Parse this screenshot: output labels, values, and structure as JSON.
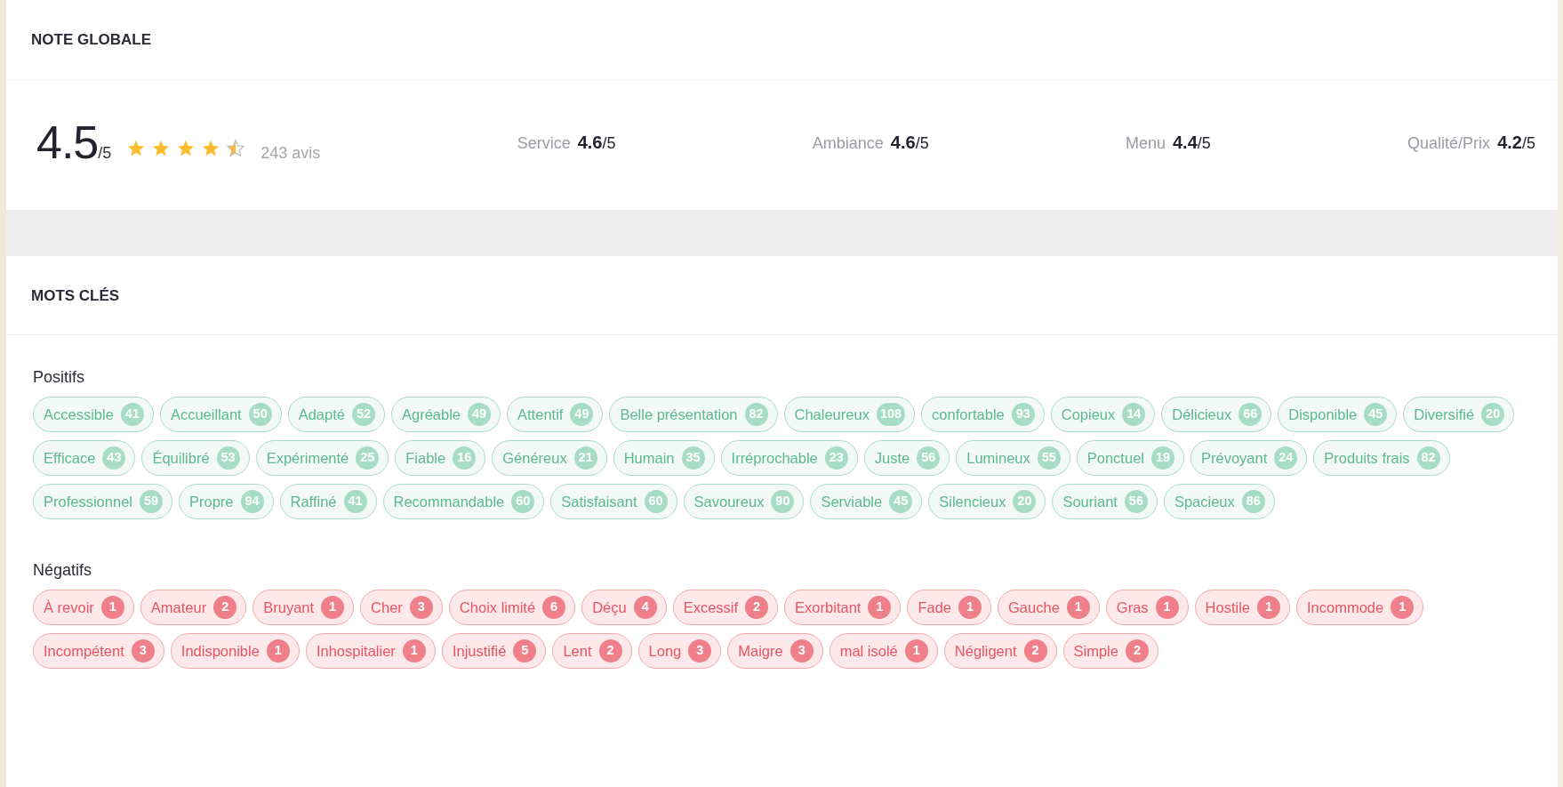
{
  "overall": {
    "title": "NOTE GLOBALE",
    "score": "4.5",
    "max": "/5",
    "stars": 4.5,
    "reviews": "243 avis",
    "criteria": [
      {
        "label": "Service",
        "value": "4.6",
        "max": "/5"
      },
      {
        "label": "Ambiance",
        "value": "4.6",
        "max": "/5"
      },
      {
        "label": "Menu",
        "value": "4.4",
        "max": "/5"
      },
      {
        "label": "Qualité/Prix",
        "value": "4.2",
        "max": "/5"
      }
    ]
  },
  "keywords": {
    "title": "MOTS CLÉS",
    "groups": [
      {
        "label": "Positifs",
        "kind": "positive",
        "tags": [
          {
            "label": "Accessible",
            "count": "41"
          },
          {
            "label": "Accueillant",
            "count": "50"
          },
          {
            "label": "Adapté",
            "count": "52"
          },
          {
            "label": "Agréable",
            "count": "49"
          },
          {
            "label": "Attentif",
            "count": "49"
          },
          {
            "label": "Belle présentation",
            "count": "82"
          },
          {
            "label": "Chaleureux",
            "count": "108"
          },
          {
            "label": "confortable",
            "count": "93"
          },
          {
            "label": "Copieux",
            "count": "14"
          },
          {
            "label": "Délicieux",
            "count": "66"
          },
          {
            "label": "Disponible",
            "count": "45"
          },
          {
            "label": "Diversifié",
            "count": "20"
          },
          {
            "label": "Efficace",
            "count": "43"
          },
          {
            "label": "Équilibré",
            "count": "53"
          },
          {
            "label": "Expérimenté",
            "count": "25"
          },
          {
            "label": "Fiable",
            "count": "16"
          },
          {
            "label": "Généreux",
            "count": "21"
          },
          {
            "label": "Humain",
            "count": "35"
          },
          {
            "label": "Irréprochable",
            "count": "23"
          },
          {
            "label": "Juste",
            "count": "56"
          },
          {
            "label": "Lumineux",
            "count": "55"
          },
          {
            "label": "Ponctuel",
            "count": "19"
          },
          {
            "label": "Prévoyant",
            "count": "24"
          },
          {
            "label": "Produits frais",
            "count": "82"
          },
          {
            "label": "Professionnel",
            "count": "59"
          },
          {
            "label": "Propre",
            "count": "94"
          },
          {
            "label": "Raffiné",
            "count": "41"
          },
          {
            "label": "Recommandable",
            "count": "60"
          },
          {
            "label": "Satisfaisant",
            "count": "60"
          },
          {
            "label": "Savoureux",
            "count": "90"
          },
          {
            "label": "Serviable",
            "count": "45"
          },
          {
            "label": "Silencieux",
            "count": "20"
          },
          {
            "label": "Souriant",
            "count": "56"
          },
          {
            "label": "Spacieux",
            "count": "86"
          }
        ]
      },
      {
        "label": "Négatifs",
        "kind": "negative",
        "tags": [
          {
            "label": "À revoir",
            "count": "1"
          },
          {
            "label": "Amateur",
            "count": "2"
          },
          {
            "label": "Bruyant",
            "count": "1"
          },
          {
            "label": "Cher",
            "count": "3"
          },
          {
            "label": "Choix limité",
            "count": "6"
          },
          {
            "label": "Déçu",
            "count": "4"
          },
          {
            "label": "Excessif",
            "count": "2"
          },
          {
            "label": "Exorbitant",
            "count": "1"
          },
          {
            "label": "Fade",
            "count": "1"
          },
          {
            "label": "Gauche",
            "count": "1"
          },
          {
            "label": "Gras",
            "count": "1"
          },
          {
            "label": "Hostile",
            "count": "1"
          },
          {
            "label": "Incommode",
            "count": "1"
          },
          {
            "label": "Incompétent",
            "count": "3"
          },
          {
            "label": "Indisponible",
            "count": "1"
          },
          {
            "label": "Inhospitalier",
            "count": "1"
          },
          {
            "label": "Injustifié",
            "count": "5"
          },
          {
            "label": "Lent",
            "count": "2"
          },
          {
            "label": "Long",
            "count": "3"
          },
          {
            "label": "Maigre",
            "count": "3"
          },
          {
            "label": "mal isolé",
            "count": "1"
          },
          {
            "label": "Négligent",
            "count": "2"
          },
          {
            "label": "Simple",
            "count": "2"
          }
        ]
      }
    ]
  }
}
